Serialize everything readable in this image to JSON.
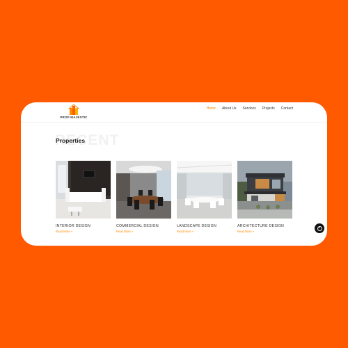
{
  "brand": {
    "name": "PROP MAJESTIC",
    "colors": {
      "accent": "#FF8A00",
      "background": "#FF5A00"
    }
  },
  "nav": {
    "items": [
      {
        "label": "Home",
        "active": true
      },
      {
        "label": "About Us",
        "active": false
      },
      {
        "label": "Services",
        "active": false
      },
      {
        "label": "Projects",
        "active": false
      },
      {
        "label": "Contact",
        "active": false
      }
    ]
  },
  "section": {
    "bg_word": "RECENT",
    "title": "Properties"
  },
  "properties": [
    {
      "title": "INTERIOR DESIGN",
      "link": "Read More »"
    },
    {
      "title": "COMMERCIAL DESIGN",
      "link": "Read More »"
    },
    {
      "title": "LANDSCAPE DESIGN",
      "link": "Read More »"
    },
    {
      "title": "ARCHITECTURE DESIGN",
      "link": "Read More »"
    }
  ],
  "icons": {
    "fab": "power-icon"
  }
}
